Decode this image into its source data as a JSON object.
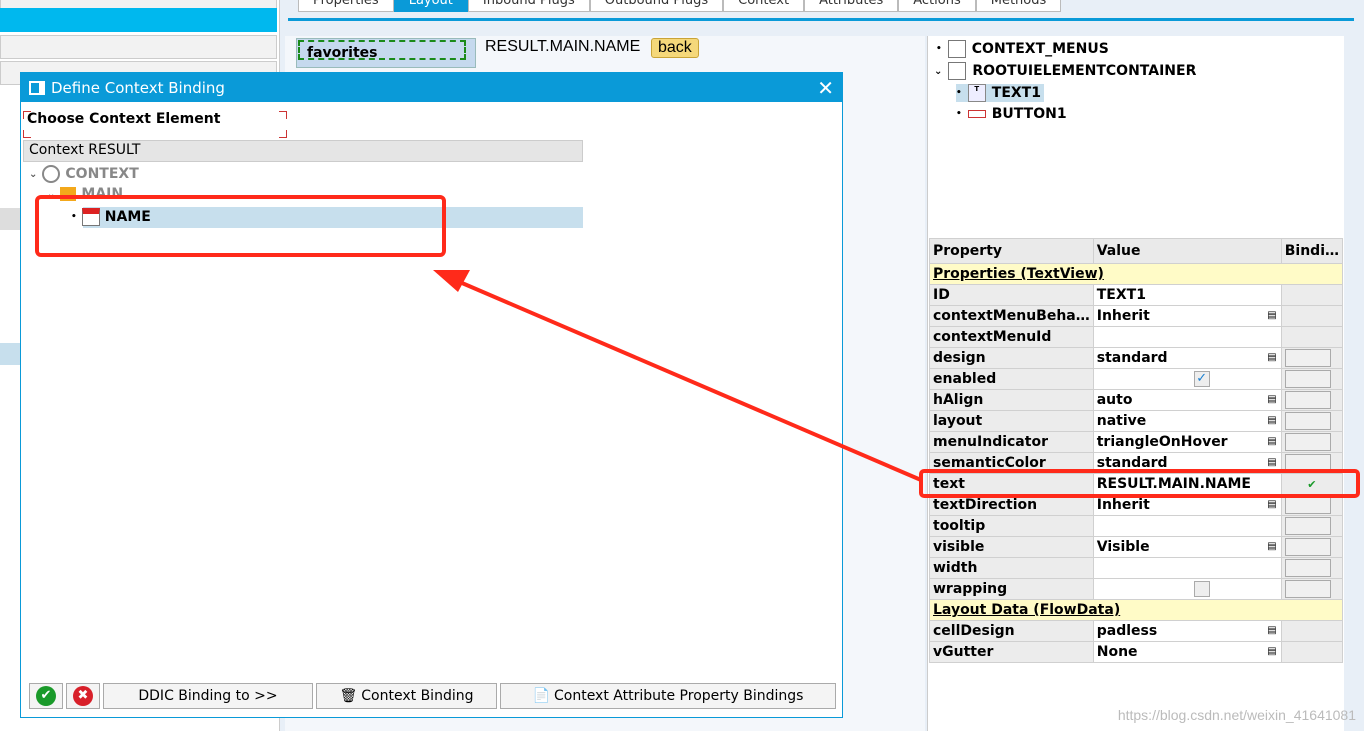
{
  "tabs": [
    "Properties",
    "Layout",
    "Inbound Plugs",
    "Outbound Plugs",
    "Context",
    "Attributes",
    "Actions",
    "Methods"
  ],
  "active_tab": "Layout",
  "layout_preview": {
    "favorites": "favorites",
    "text": "RESULT.MAIN.NAME",
    "back": "back"
  },
  "ui_tree": [
    {
      "label": "CONTEXT_MENUS"
    },
    {
      "label": "ROOTUIELEMENTCONTAINER"
    },
    {
      "label": "TEXT1"
    },
    {
      "label": "BUTTON1"
    }
  ],
  "props": {
    "headers": [
      "Property",
      "Value",
      "Bindi…"
    ],
    "group1": "Properties (TextView)",
    "rows": [
      {
        "p": "ID",
        "v": "TEXT1"
      },
      {
        "p": "contextMenuBeha…",
        "v": "Inherit",
        "dd": true
      },
      {
        "p": "contextMenuId",
        "v": ""
      },
      {
        "p": "design",
        "v": "standard",
        "dd": true,
        "bind": true
      },
      {
        "p": "enabled",
        "v": "",
        "check": true,
        "bind": true
      },
      {
        "p": "hAlign",
        "v": "auto",
        "dd": true,
        "bind": true
      },
      {
        "p": "layout",
        "v": "native",
        "dd": true,
        "bind": true
      },
      {
        "p": "menuIndicator",
        "v": "triangleOnHover",
        "dd": true,
        "bind": true
      },
      {
        "p": "semanticColor",
        "v": "standard",
        "dd": true,
        "bind": true
      },
      {
        "p": "text",
        "v": "RESULT.MAIN.NAME",
        "bound": true
      },
      {
        "p": "textDirection",
        "v": "Inherit",
        "dd": true,
        "bind": true
      },
      {
        "p": "tooltip",
        "v": "",
        "bind": true
      },
      {
        "p": "visible",
        "v": "Visible",
        "dd": true,
        "bind": true
      },
      {
        "p": "width",
        "v": "",
        "bind": true
      },
      {
        "p": "wrapping",
        "v": "",
        "uncheck": true,
        "bind": true
      }
    ],
    "group2": "Layout Data (FlowData)",
    "rows2": [
      {
        "p": "cellDesign",
        "v": "padless",
        "dd": true
      },
      {
        "p": "vGutter",
        "v": "None",
        "dd": true
      }
    ]
  },
  "dialog": {
    "title": "Define Context Binding",
    "section": "Choose Context Element",
    "context_header": "Context RESULT",
    "tree": {
      "root": "CONTEXT",
      "node": "MAIN",
      "leaf": "NAME"
    },
    "buttons": {
      "ddic": "DDIC Binding to >>",
      "ctx": "Context Binding",
      "attr": "Context Attribute Property Bindings"
    }
  },
  "watermark": "https://blog.csdn.net/weixin_41641081",
  "colors": {
    "accent": "#0a9ad8",
    "annotation": "#ff2a1a"
  }
}
